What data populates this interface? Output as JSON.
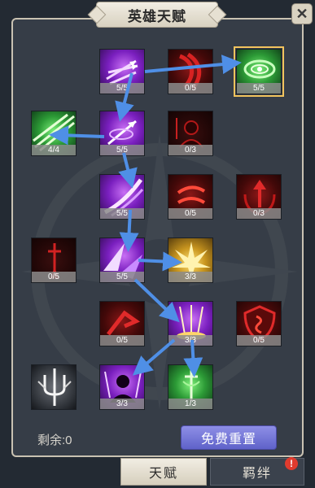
{
  "header": {
    "title": "英雄天赋",
    "close_icon": "close-x-icon"
  },
  "nodes": [
    {
      "id": "n1",
      "level": "5/5",
      "icon": "triple-arrow-icon",
      "theme": "purple"
    },
    {
      "id": "n2",
      "level": "0/5",
      "icon": "crimson-claw-icon",
      "theme": "red"
    },
    {
      "id": "n3",
      "level": "5/5",
      "icon": "green-vortex-icon",
      "theme": "green",
      "selected": true
    },
    {
      "id": "n4",
      "level": "4/4",
      "icon": "green-blade-burst-icon",
      "theme": "green"
    },
    {
      "id": "n5",
      "level": "5/5",
      "icon": "piercing-arrow-icon",
      "theme": "purple"
    },
    {
      "id": "n6",
      "level": "0/3",
      "icon": "dark-rogue-icon",
      "theme": "dark"
    },
    {
      "id": "n7",
      "level": "5/5",
      "icon": "purple-slash-icon",
      "theme": "purple"
    },
    {
      "id": "n8",
      "level": "0/5",
      "icon": "red-whirl-icon",
      "theme": "red"
    },
    {
      "id": "n9",
      "level": "0/3",
      "icon": "red-arrow-shield-icon",
      "theme": "red"
    },
    {
      "id": "n10",
      "level": "0/5",
      "icon": "red-sword-icon",
      "theme": "dark"
    },
    {
      "id": "n11",
      "level": "5/5",
      "icon": "purple-shards-icon",
      "theme": "purple"
    },
    {
      "id": "n12",
      "level": "3/3",
      "icon": "gold-burst-icon",
      "theme": "gold"
    },
    {
      "id": "n13",
      "level": "0/5",
      "icon": "red-hook-icon",
      "theme": "red"
    },
    {
      "id": "n14",
      "level": "3/3",
      "icon": "sword-rain-icon",
      "theme": "purple"
    },
    {
      "id": "n15",
      "level": "0/5",
      "icon": "red-shield-icon",
      "theme": "red"
    },
    {
      "id": "n16",
      "level": "",
      "icon": "silver-trident-icon",
      "theme": "gray"
    },
    {
      "id": "n17",
      "level": "3/3",
      "icon": "shadow-ninja-icon",
      "theme": "purple"
    },
    {
      "id": "n18",
      "level": "1/3",
      "icon": "green-sword-icon",
      "theme": "green"
    }
  ],
  "footer": {
    "remaining": "剩余:0",
    "reset_button": "免费重置"
  },
  "tabs": {
    "talent": "天赋",
    "bond": "羁绊",
    "bond_badge": "!"
  },
  "colors": {
    "arrow": "#4f8fe6",
    "selected_outline": "#f2c35d",
    "reset_button": "#7275d8"
  }
}
